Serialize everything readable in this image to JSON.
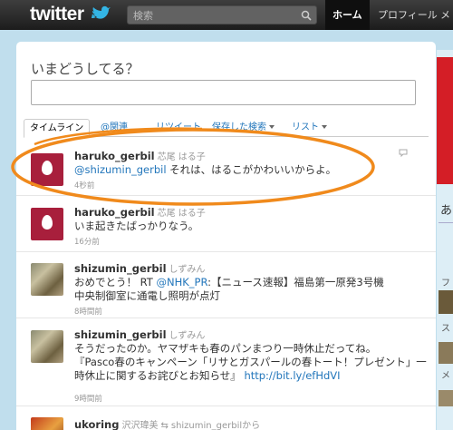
{
  "header": {
    "logo": "twitter",
    "search_placeholder": "検索",
    "nav": {
      "home": "ホーム",
      "profile": "プロフィール",
      "more": "メ"
    }
  },
  "compose": {
    "prompt": "いまどうしてる？"
  },
  "tabs": {
    "timeline": "タイムライン",
    "mentions": "@関連",
    "retweets": "リツイート",
    "saved_searches": "保存した検索",
    "lists": "リスト"
  },
  "tweets": [
    {
      "screen_name": "haruko_gerbil",
      "full_name": "芯尾 はる子",
      "mention": "@shizumin_gerbil",
      "text": " それは、はるこがかわいいからよ。",
      "time": "4秒前"
    },
    {
      "screen_name": "haruko_gerbil",
      "full_name": "芯尾 はる子",
      "text": "いま起きたばっかりなう。",
      "time": "16分前"
    },
    {
      "screen_name": "shizumin_gerbil",
      "full_name": "しずみん",
      "text_part1": "おめでとう！ RT ",
      "mention": "@NHK_PR",
      "text_part2": ":【ニュース速報】福島第一原発3号機",
      "text_line2": "中央制御室に通電し照明が点灯",
      "time": "8時間前"
    },
    {
      "screen_name": "shizumin_gerbil",
      "full_name": "しずみん",
      "line1": "そうだったのか。ヤマザキも春のパンまつり一時休止だってね。",
      "line2": "『Pasco春のキャンペーン「リサとガスパールの春トート！プレゼント」一",
      "line3": "時休止に関するお詫びとお知らせ』",
      "link": "http://bit.ly/efHdVI",
      "time": "9時間前"
    },
    {
      "screen_name": "ukoring",
      "full_name": "沢沢瑋美",
      "retweet_by": "shizumin_gerbilから"
    }
  ],
  "dashboard": {
    "text1": "あ",
    "text2": "フ",
    "text3": "ス",
    "text4": "メ"
  },
  "colors": {
    "link": "#2276bb",
    "highlight": "#f08a1c",
    "egg_avatar": "#a81f3c",
    "topbar": "#2a2a2a",
    "background": "#c0deed"
  }
}
